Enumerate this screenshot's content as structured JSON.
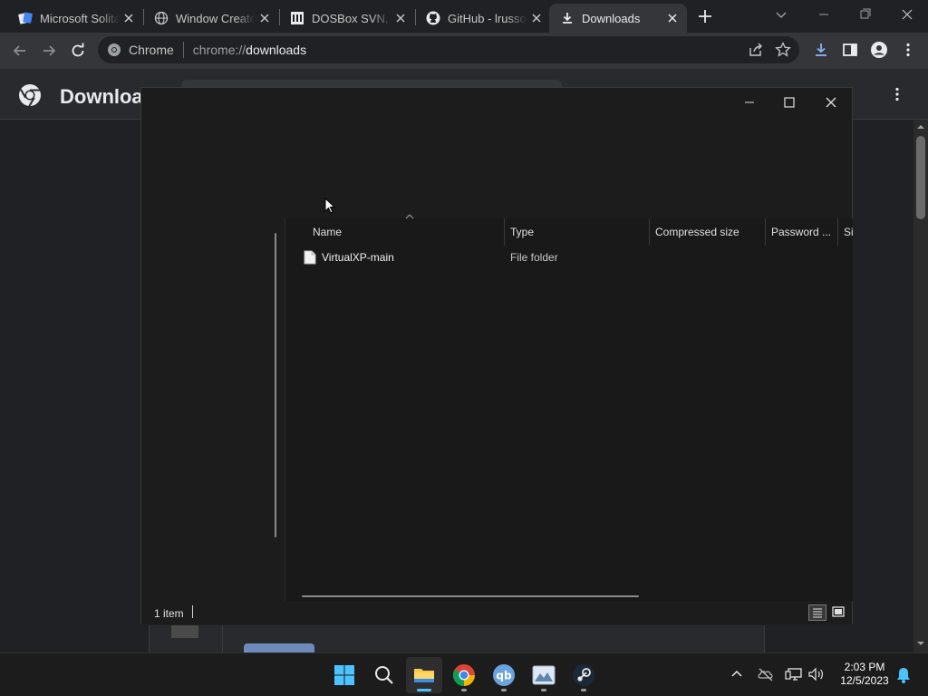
{
  "tabs": [
    {
      "title": "Microsoft Solitaire",
      "icon": "solitaire-icon"
    },
    {
      "title": "Window Creator",
      "icon": "globe-icon"
    },
    {
      "title": "DOSBox SVN, CVS",
      "icon": "bank-icon"
    },
    {
      "title": "GitHub - lrusso",
      "icon": "github-icon"
    },
    {
      "title": "Downloads",
      "icon": "download-icon"
    }
  ],
  "omnibox": {
    "chip": "Chrome",
    "scheme": "chrome://",
    "host": "downloads"
  },
  "page": {
    "title": "Downloads"
  },
  "explorer": {
    "columns": [
      "Name",
      "Type",
      "Compressed size",
      "Password ...",
      "Size"
    ],
    "rows": [
      {
        "name": "VirtualXP-main",
        "type": "File folder"
      }
    ],
    "status": "1 item"
  },
  "clock": {
    "time": "2:03 PM",
    "date": "12/5/2023"
  },
  "colors": {
    "accent": "#8ab4f8",
    "bg": "#202124",
    "toolbar": "#35363a",
    "explorer_bg": "#191919"
  }
}
